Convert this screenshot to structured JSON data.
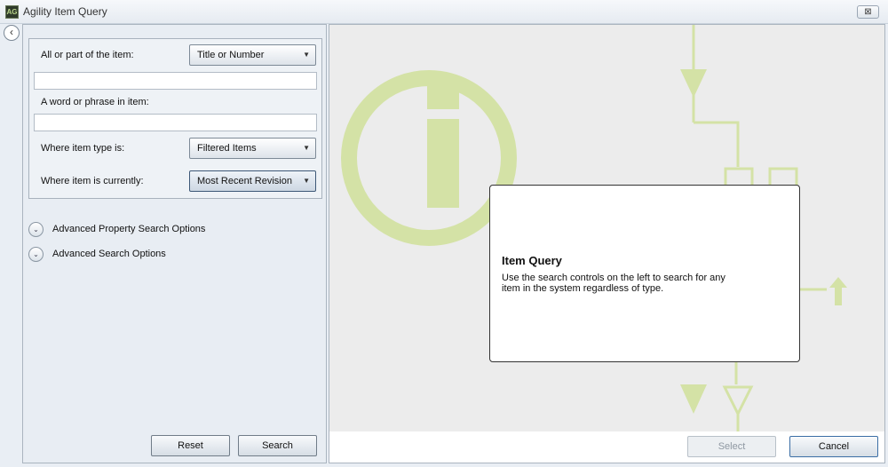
{
  "window": {
    "title": "Agility Item Query",
    "app_icon": "AG",
    "close_glyph": "⊠",
    "collapse_glyph": "‹"
  },
  "search": {
    "label_item": "All or part of the item:",
    "item_scope_select": "Title or Number",
    "item_value": "",
    "label_phrase": "A word or phrase in item:",
    "phrase_value": "",
    "label_type": "Where item type is:",
    "type_select": "Filtered Items",
    "label_current": "Where item is currently:",
    "current_select": "Most Recent Revision",
    "caret": "▼"
  },
  "expanders": {
    "glyph": "⌄",
    "advanced_property": "Advanced Property Search Options",
    "advanced_search": "Advanced Search Options"
  },
  "buttons": {
    "reset": "Reset",
    "search": "Search",
    "select": "Select",
    "cancel": "Cancel"
  },
  "info": {
    "title": "Item Query",
    "text": "Use the search controls on the left to search for any item in the system regardless of type."
  },
  "colors": {
    "art_green": "#d4e2a6",
    "panel_bg": "#e8edf3",
    "content_bg": "#ececec"
  }
}
